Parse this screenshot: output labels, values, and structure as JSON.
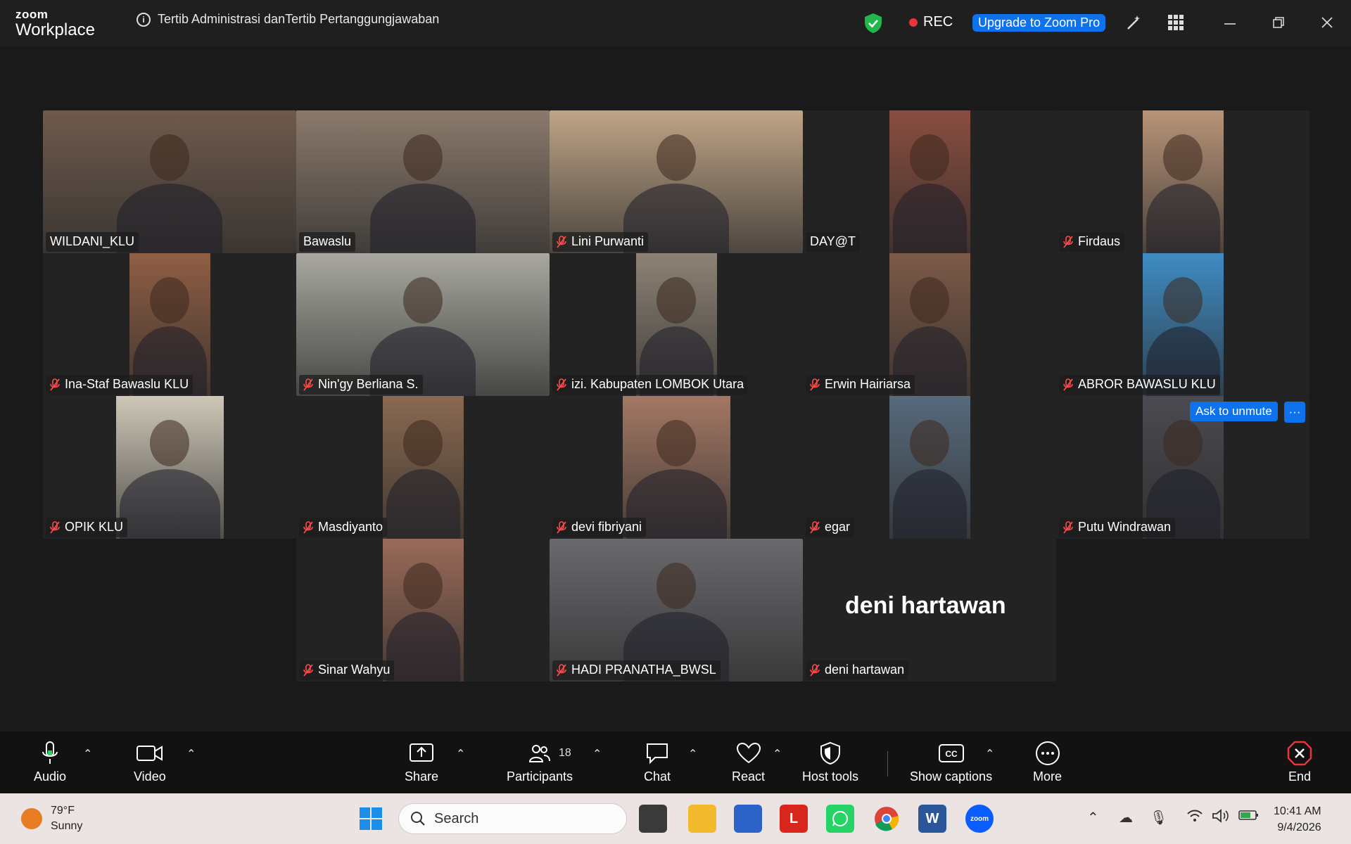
{
  "app": {
    "brand_top": "zoom",
    "brand_bottom": "Workplace"
  },
  "meeting": {
    "topic": "Tertib Administrasi danTertib Pertanggungjawaban",
    "rec_label": "REC",
    "upgrade_label": "Upgrade to Zoom Pro"
  },
  "tiles": [
    {
      "name": "WILDANI_KLU",
      "muted": false,
      "bg": "#6f5a4c"
    },
    {
      "name": "Bawaslu",
      "muted": false,
      "bg": "#8b7a6c",
      "active": true
    },
    {
      "name": "Lini Purwanti",
      "muted": true,
      "bg": "#bfa486"
    },
    {
      "name": "DAY@T",
      "muted": false,
      "bg": "#8a4d3f"
    },
    {
      "name": "Firdaus",
      "muted": true,
      "bg": "#b99478"
    },
    {
      "name": "Ina-Staf Bawaslu KLU",
      "muted": true,
      "bg": "#8f5e44"
    },
    {
      "name": "Nin'gy Berliana S.",
      "muted": true,
      "bg": "#a8a8a0"
    },
    {
      "name": "izi. Kabupaten LOMBOK Utara",
      "muted": true,
      "bg": "#8d8276"
    },
    {
      "name": "Erwin Hairiarsa",
      "muted": true,
      "bg": "#7d5a48"
    },
    {
      "name": "ABROR BAWASLU KLU",
      "muted": true,
      "bg": "#3e8cc4"
    },
    {
      "name": "OPIK KLU",
      "muted": true,
      "bg": "#cfc8b8"
    },
    {
      "name": "Masdiyanto",
      "muted": true,
      "bg": "#8a6950"
    },
    {
      "name": "devi fibriyani",
      "muted": true,
      "bg": "#a47864"
    },
    {
      "name": "egar",
      "muted": true,
      "bg": "#586a7c"
    },
    {
      "name": "Putu Windrawan",
      "muted": true,
      "bg": "#4a4a50"
    },
    {
      "name": "Sinar Wahyu",
      "muted": true,
      "bg": "#9a6a58"
    },
    {
      "name": "HADI PRANATHA_BWSL",
      "muted": true,
      "bg": "#6a6a6e"
    },
    {
      "name": "deni hartawan",
      "muted": true,
      "bg": "#232323",
      "no_video": true
    }
  ],
  "ask_to_unmute_label": "Ask to unmute",
  "more_dots": "···",
  "toolbar": {
    "audio": "Audio",
    "video": "Video",
    "share": "Share",
    "participants": "Participants",
    "participants_count": "18",
    "chat": "Chat",
    "react": "React",
    "host_tools": "Host tools",
    "captions": "Show captions",
    "more": "More",
    "end": "End"
  },
  "taskbar": {
    "temp": "79°F",
    "condition": "Sunny",
    "search_placeholder": "Search",
    "time": "10:41 AM",
    "date": "9/4/2026"
  }
}
